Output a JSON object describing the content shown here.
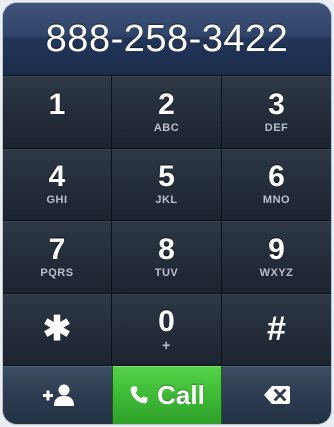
{
  "display": {
    "number": "888-258-3422"
  },
  "keypad": {
    "keys": [
      {
        "digit": "1",
        "letters": ""
      },
      {
        "digit": "2",
        "letters": "ABC"
      },
      {
        "digit": "3",
        "letters": "DEF"
      },
      {
        "digit": "4",
        "letters": "GHI"
      },
      {
        "digit": "5",
        "letters": "JKL"
      },
      {
        "digit": "6",
        "letters": "MNO"
      },
      {
        "digit": "7",
        "letters": "PQRS"
      },
      {
        "digit": "8",
        "letters": "TUV"
      },
      {
        "digit": "9",
        "letters": "WXYZ"
      },
      {
        "digit": "✱",
        "letters": ""
      },
      {
        "digit": "0",
        "letters": "+"
      },
      {
        "digit": "#",
        "letters": ""
      }
    ]
  },
  "actions": {
    "add_contact_icon": "add-contact-icon",
    "call_label": "Call",
    "call_icon": "phone-icon",
    "delete_icon": "backspace-icon"
  },
  "colors": {
    "call_green": "#3eba36",
    "display_blue": "#2d4168",
    "key_dark": "#242d39"
  }
}
